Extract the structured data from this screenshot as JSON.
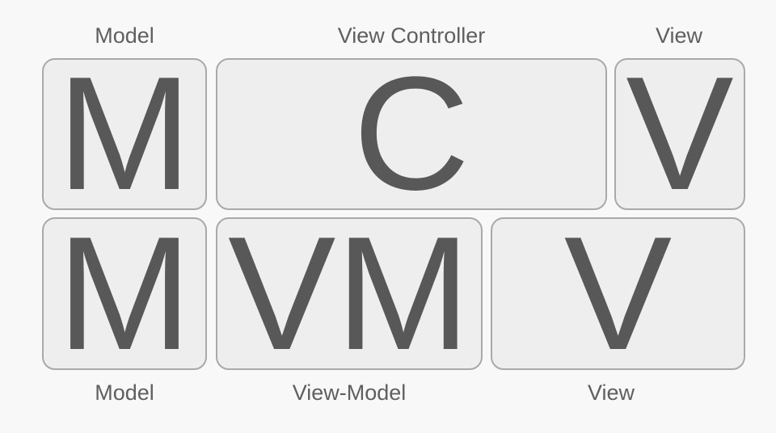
{
  "top_row": {
    "model": {
      "caption": "Model",
      "letter": "M"
    },
    "controller": {
      "caption": "View Controller",
      "letter": "C"
    },
    "view": {
      "caption": "View",
      "letter": "V"
    }
  },
  "bottom_row": {
    "model": {
      "caption": "Model",
      "letter": "M"
    },
    "viewmodel": {
      "caption": "View-Model",
      "letter": "VM"
    },
    "view": {
      "caption": "View",
      "letter": "V"
    }
  },
  "colors": {
    "background": "#f8f8f8",
    "box_fill": "#eeeeee",
    "box_border": "#a9a9a9",
    "letter": "#585858",
    "caption": "#5f5f5f"
  }
}
